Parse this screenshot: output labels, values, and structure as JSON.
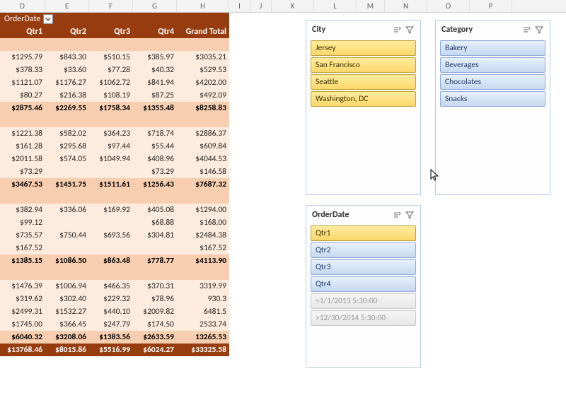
{
  "column_letters": [
    "D",
    "E",
    "F",
    "G",
    "H",
    "I",
    "J",
    "K",
    "L",
    "M",
    "N",
    "O",
    "P"
  ],
  "pivot": {
    "field_label": "OrderDate",
    "headers": [
      "Qtr1",
      "Qtr2",
      "Qtr3",
      "Qtr4",
      "Grand Total"
    ],
    "groups": [
      {
        "rows": [
          [
            "$1295.79",
            "$843.30",
            "$510.15",
            "$385.97",
            "$3035.21"
          ],
          [
            "$378.33",
            "$33.60",
            "$77.28",
            "$40.32",
            "$529.53"
          ],
          [
            "$1121.07",
            "$1176.27",
            "$1062.72",
            "$841.94",
            "$4202.00"
          ],
          [
            "$80.27",
            "$216.38",
            "$108.19",
            "$87.25",
            "$492.09"
          ]
        ],
        "subtotal": [
          "$2875.46",
          "$2269.55",
          "$1758.34",
          "$1355.48",
          "$8258.83"
        ]
      },
      {
        "rows": [
          [
            "$1221.38",
            "$582.02",
            "$364.23",
            "$718.74",
            "$2886.37"
          ],
          [
            "$161.28",
            "$295.68",
            "$97.44",
            "$55.44",
            "$609.84"
          ],
          [
            "$2011.58",
            "$574.05",
            "$1049.94",
            "$408.96",
            "$4044.53"
          ],
          [
            "$73.29",
            "",
            "",
            "$73.29",
            "$146.58"
          ]
        ],
        "subtotal": [
          "$3467.53",
          "$1451.75",
          "$1511.61",
          "$1256.43",
          "$7687.32"
        ]
      },
      {
        "rows": [
          [
            "$382.94",
            "$336.06",
            "$169.92",
            "$405.08",
            "$1294.00"
          ],
          [
            "$99.12",
            "",
            "",
            "$68.88",
            "$168.00"
          ],
          [
            "$735.57",
            "$750.44",
            "$693.56",
            "$304.81",
            "$2484.38"
          ],
          [
            "$167.52",
            "",
            "",
            "",
            "$167.52"
          ]
        ],
        "subtotal": [
          "$1385.15",
          "$1086.50",
          "$863.48",
          "$778.77",
          "$4113.90"
        ]
      },
      {
        "rows": [
          [
            "$1476.39",
            "$1006.94",
            "$466.35",
            "$370.31",
            "3319.99"
          ],
          [
            "$319.62",
            "$302.40",
            "$229.32",
            "$78.96",
            "930.3"
          ],
          [
            "$2499.31",
            "$1532.27",
            "$440.10",
            "$2009.82",
            "6481.5"
          ],
          [
            "$1745.00",
            "$366.45",
            "$247.79",
            "$174.50",
            "2533.74"
          ]
        ],
        "subtotal": [
          "$6040.32",
          "$3208.06",
          "$1383.56",
          "$2633.59",
          "13265.53"
        ]
      }
    ],
    "grand_total": [
      "$13768.46",
      "$8015.86",
      "$5516.99",
      "$6024.27",
      "$33325.58"
    ]
  },
  "slicers": {
    "city": {
      "title": "City",
      "items": [
        {
          "label": "Jersey",
          "state": "sel"
        },
        {
          "label": "San Francisco",
          "state": "sel"
        },
        {
          "label": "Seattle",
          "state": "sel"
        },
        {
          "label": "Washington, DC",
          "state": "sel"
        }
      ]
    },
    "category": {
      "title": "Category",
      "items": [
        {
          "label": "Bakery",
          "state": ""
        },
        {
          "label": "Beverages",
          "state": ""
        },
        {
          "label": "Chocolates",
          "state": ""
        },
        {
          "label": "Snacks",
          "state": ""
        }
      ]
    },
    "orderdate": {
      "title": "OrderDate",
      "items": [
        {
          "label": "Qtr1",
          "state": "sel"
        },
        {
          "label": "Qtr2",
          "state": ""
        },
        {
          "label": "Qtr3",
          "state": ""
        },
        {
          "label": "Qtr4",
          "state": ""
        },
        {
          "label": "<1/1/2013 5:30:00",
          "state": "dim"
        },
        {
          "label": ">12/30/2014 5:30:00",
          "state": "dim"
        }
      ]
    }
  }
}
